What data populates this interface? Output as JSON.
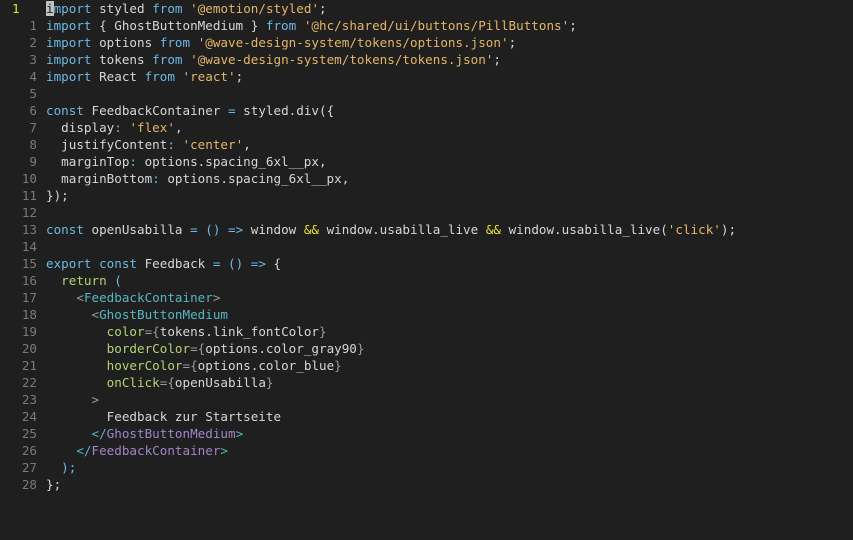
{
  "editor": {
    "lines": [
      {
        "num": "1",
        "current": true,
        "tokens": [
          {
            "t": "i",
            "c": "cursor-block"
          },
          {
            "t": "mport",
            "c": "tk-kw"
          },
          {
            "t": " styled ",
            "c": "tk-plain"
          },
          {
            "t": "from",
            "c": "tk-kw"
          },
          {
            "t": " ",
            "c": "tk-plain"
          },
          {
            "t": "'@emotion/styled'",
            "c": "tk-str"
          },
          {
            "t": ";",
            "c": "tk-plain"
          }
        ]
      },
      {
        "num": "1",
        "tokens": [
          {
            "t": "import",
            "c": "tk-kw"
          },
          {
            "t": " { GhostButtonMedium } ",
            "c": "tk-plain"
          },
          {
            "t": "from",
            "c": "tk-kw"
          },
          {
            "t": " ",
            "c": "tk-plain"
          },
          {
            "t": "'@hc/shared/ui/buttons/PillButtons'",
            "c": "tk-str"
          },
          {
            "t": ";",
            "c": "tk-plain"
          }
        ]
      },
      {
        "num": "2",
        "tokens": [
          {
            "t": "import",
            "c": "tk-kw"
          },
          {
            "t": " options ",
            "c": "tk-plain"
          },
          {
            "t": "from",
            "c": "tk-kw"
          },
          {
            "t": " ",
            "c": "tk-plain"
          },
          {
            "t": "'@wave-design-system/tokens/options.json'",
            "c": "tk-str"
          },
          {
            "t": ";",
            "c": "tk-plain"
          }
        ]
      },
      {
        "num": "3",
        "tokens": [
          {
            "t": "import",
            "c": "tk-kw"
          },
          {
            "t": " tokens ",
            "c": "tk-plain"
          },
          {
            "t": "from",
            "c": "tk-kw"
          },
          {
            "t": " ",
            "c": "tk-plain"
          },
          {
            "t": "'@wave-design-system/tokens/tokens.json'",
            "c": "tk-str"
          },
          {
            "t": ";",
            "c": "tk-plain"
          }
        ]
      },
      {
        "num": "4",
        "tokens": [
          {
            "t": "import",
            "c": "tk-kw"
          },
          {
            "t": " React ",
            "c": "tk-plain"
          },
          {
            "t": "from",
            "c": "tk-kw"
          },
          {
            "t": " ",
            "c": "tk-plain"
          },
          {
            "t": "'react'",
            "c": "tk-str"
          },
          {
            "t": ";",
            "c": "tk-plain"
          }
        ]
      },
      {
        "num": "5",
        "tokens": []
      },
      {
        "num": "6",
        "tokens": [
          {
            "t": "const",
            "c": "tk-kw"
          },
          {
            "t": " FeedbackContainer ",
            "c": "tk-plain"
          },
          {
            "t": "=",
            "c": "tk-kw"
          },
          {
            "t": " styled.div({",
            "c": "tk-plain"
          }
        ]
      },
      {
        "num": "7",
        "tokens": [
          {
            "t": "  display",
            "c": "tk-plain"
          },
          {
            "t": ":",
            "c": "tk-kw"
          },
          {
            "t": " ",
            "c": "tk-plain"
          },
          {
            "t": "'flex'",
            "c": "tk-str"
          },
          {
            "t": ",",
            "c": "tk-plain"
          }
        ]
      },
      {
        "num": "8",
        "tokens": [
          {
            "t": "  justifyContent",
            "c": "tk-plain"
          },
          {
            "t": ":",
            "c": "tk-kw"
          },
          {
            "t": " ",
            "c": "tk-plain"
          },
          {
            "t": "'center'",
            "c": "tk-str"
          },
          {
            "t": ",",
            "c": "tk-plain"
          }
        ]
      },
      {
        "num": "9",
        "tokens": [
          {
            "t": "  marginTop",
            "c": "tk-plain"
          },
          {
            "t": ":",
            "c": "tk-kw"
          },
          {
            "t": " options.spacing_6xl__px,",
            "c": "tk-plain"
          }
        ]
      },
      {
        "num": "10",
        "tokens": [
          {
            "t": "  marginBottom",
            "c": "tk-plain"
          },
          {
            "t": ":",
            "c": "tk-kw"
          },
          {
            "t": " options.spacing_6xl__px,",
            "c": "tk-plain"
          }
        ]
      },
      {
        "num": "11",
        "tokens": [
          {
            "t": "});",
            "c": "tk-plain"
          }
        ]
      },
      {
        "num": "12",
        "tokens": []
      },
      {
        "num": "13",
        "tokens": [
          {
            "t": "const",
            "c": "tk-kw"
          },
          {
            "t": " openUsabilla ",
            "c": "tk-plain"
          },
          {
            "t": "= () =>",
            "c": "tk-kw"
          },
          {
            "t": " window ",
            "c": "tk-plain"
          },
          {
            "t": "&&",
            "c": "tk-op"
          },
          {
            "t": " window.usabilla_live ",
            "c": "tk-plain"
          },
          {
            "t": "&&",
            "c": "tk-op"
          },
          {
            "t": " window.usabilla_live(",
            "c": "tk-plain"
          },
          {
            "t": "'click'",
            "c": "tk-str"
          },
          {
            "t": ");",
            "c": "tk-plain"
          }
        ]
      },
      {
        "num": "14",
        "tokens": []
      },
      {
        "num": "15",
        "tokens": [
          {
            "t": "export",
            "c": "tk-kw"
          },
          {
            "t": " ",
            "c": "tk-plain"
          },
          {
            "t": "const",
            "c": "tk-kw"
          },
          {
            "t": " Feedback ",
            "c": "tk-plain"
          },
          {
            "t": "= () =>",
            "c": "tk-kw"
          },
          {
            "t": " {",
            "c": "tk-plain"
          }
        ]
      },
      {
        "num": "16",
        "tokens": [
          {
            "t": "  ",
            "c": "tk-plain"
          },
          {
            "t": "return",
            "c": "tk-fn"
          },
          {
            "t": " (",
            "c": "tk-kw"
          }
        ]
      },
      {
        "num": "17",
        "tokens": [
          {
            "t": "    ",
            "c": "tk-plain"
          },
          {
            "t": "<",
            "c": "tk-brace"
          },
          {
            "t": "FeedbackContainer",
            "c": "tk-jsxtag"
          },
          {
            "t": ">",
            "c": "tk-brace"
          }
        ]
      },
      {
        "num": "18",
        "tokens": [
          {
            "t": "      ",
            "c": "tk-plain"
          },
          {
            "t": "<",
            "c": "tk-brace"
          },
          {
            "t": "GhostButtonMedium",
            "c": "tk-jsxtag"
          }
        ]
      },
      {
        "num": "19",
        "tokens": [
          {
            "t": "        ",
            "c": "tk-plain"
          },
          {
            "t": "color",
            "c": "tk-attr"
          },
          {
            "t": "={",
            "c": "tk-brace"
          },
          {
            "t": "tokens.link_fontColor",
            "c": "tk-plain"
          },
          {
            "t": "}",
            "c": "tk-brace"
          }
        ]
      },
      {
        "num": "20",
        "tokens": [
          {
            "t": "        ",
            "c": "tk-plain"
          },
          {
            "t": "borderColor",
            "c": "tk-attr"
          },
          {
            "t": "={",
            "c": "tk-brace"
          },
          {
            "t": "options.color_gray90",
            "c": "tk-plain"
          },
          {
            "t": "}",
            "c": "tk-brace"
          }
        ]
      },
      {
        "num": "21",
        "tokens": [
          {
            "t": "        ",
            "c": "tk-plain"
          },
          {
            "t": "hoverColor",
            "c": "tk-attr"
          },
          {
            "t": "={",
            "c": "tk-brace"
          },
          {
            "t": "options.color_blue",
            "c": "tk-plain"
          },
          {
            "t": "}",
            "c": "tk-brace"
          }
        ]
      },
      {
        "num": "22",
        "tokens": [
          {
            "t": "        ",
            "c": "tk-plain"
          },
          {
            "t": "onClick",
            "c": "tk-attr"
          },
          {
            "t": "={",
            "c": "tk-brace"
          },
          {
            "t": "openUsabilla",
            "c": "tk-plain"
          },
          {
            "t": "}",
            "c": "tk-brace"
          }
        ]
      },
      {
        "num": "23",
        "tokens": [
          {
            "t": "      ",
            "c": "tk-plain"
          },
          {
            "t": ">",
            "c": "tk-brace"
          }
        ]
      },
      {
        "num": "24",
        "tokens": [
          {
            "t": "        Feedback zur Startseite",
            "c": "tk-plain"
          }
        ]
      },
      {
        "num": "25",
        "tokens": [
          {
            "t": "      ",
            "c": "tk-plain"
          },
          {
            "t": "</",
            "c": "tk-jsxtag"
          },
          {
            "t": "GhostButtonMedium",
            "c": "tk-tag"
          },
          {
            "t": ">",
            "c": "tk-jsxtag"
          }
        ]
      },
      {
        "num": "26",
        "tokens": [
          {
            "t": "    ",
            "c": "tk-plain"
          },
          {
            "t": "</",
            "c": "tk-jsxtag"
          },
          {
            "t": "FeedbackContainer",
            "c": "tk-tag"
          },
          {
            "t": ">",
            "c": "tk-jsxtag"
          }
        ]
      },
      {
        "num": "27",
        "tokens": [
          {
            "t": "  );",
            "c": "tk-kw"
          }
        ]
      },
      {
        "num": "28",
        "tokens": [
          {
            "t": "};",
            "c": "tk-plain"
          }
        ]
      }
    ]
  },
  "colors": {
    "background": "#1f1f1f",
    "line_number": "#7a7a7a",
    "current_line_number": "#e8e233",
    "keyword": "#6cb8e6",
    "string": "#e5b567",
    "jsx_tag": "#56b6c2",
    "attribute": "#b4d273"
  }
}
